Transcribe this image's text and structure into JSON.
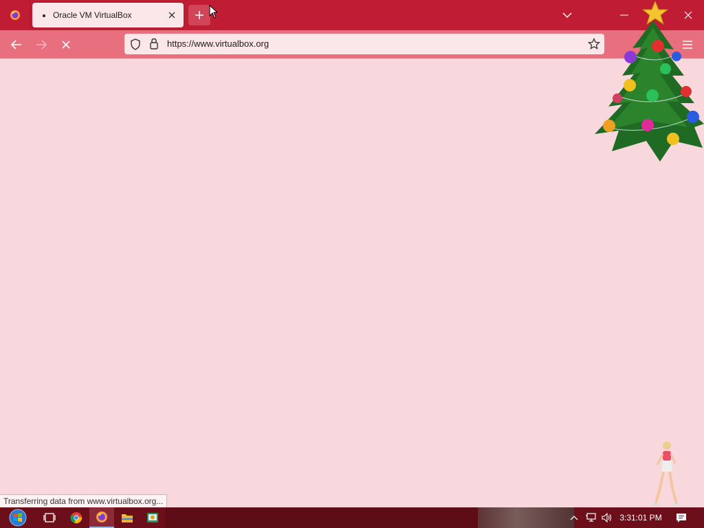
{
  "browser": {
    "tab": {
      "title": "Oracle VM VirtualBox"
    },
    "url": "https://www.virtualbox.org",
    "status_text": "Transferring data from www.virtualbox.org..."
  },
  "taskbar": {
    "clock": "3:31:01 PM",
    "items": [
      "start-orb",
      "task-view",
      "chrome",
      "firefox",
      "file-explorer",
      "network-app"
    ]
  },
  "colors": {
    "tab_strip": "#c01c33",
    "nav_bar": "#e8707e",
    "content_bg": "#f8d7dd",
    "taskbar": "#6d0f1a"
  }
}
